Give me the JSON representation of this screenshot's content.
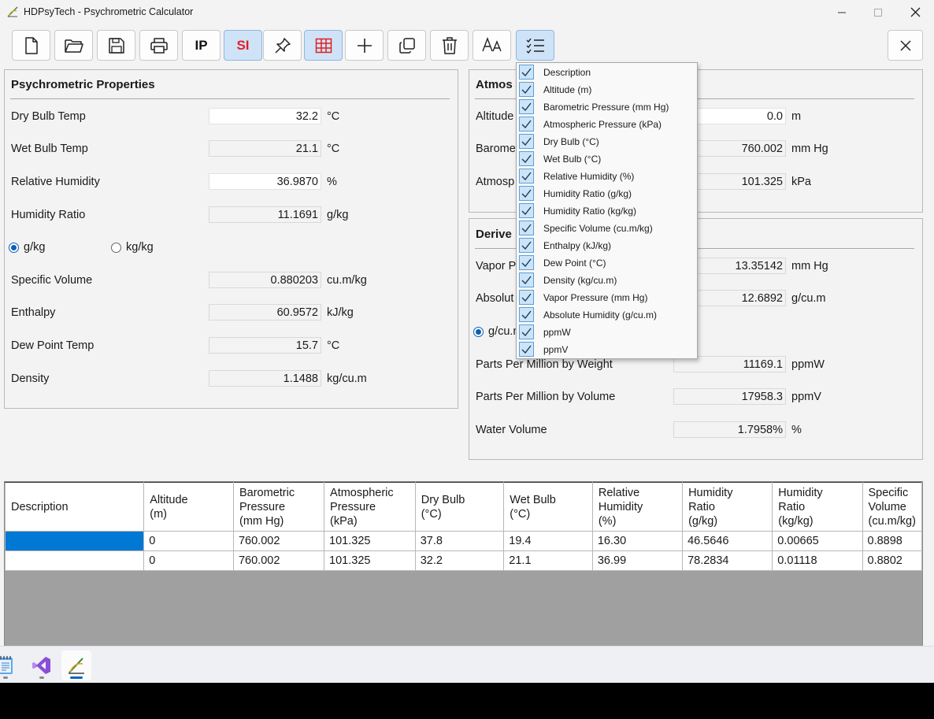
{
  "window": {
    "title": "HDPsyTech - Psychrometric Calculator"
  },
  "toolbar": {
    "buttons": [
      {
        "name": "new-file",
        "icon": "new-file-icon"
      },
      {
        "name": "open-folder",
        "icon": "folder-icon"
      },
      {
        "name": "save",
        "icon": "save-icon"
      },
      {
        "name": "print",
        "icon": "printer-icon"
      },
      {
        "name": "ip-units",
        "label": "IP"
      },
      {
        "name": "si-units",
        "label": "SI",
        "active": true
      },
      {
        "name": "pin",
        "icon": "pin-icon"
      },
      {
        "name": "grid",
        "icon": "grid-icon",
        "active": true
      },
      {
        "name": "add",
        "icon": "plus-icon"
      },
      {
        "name": "copy",
        "icon": "copy-icon"
      },
      {
        "name": "delete",
        "icon": "trash-icon"
      },
      {
        "name": "font",
        "icon": "font-size-icon"
      },
      {
        "name": "columns",
        "icon": "checklist-icon",
        "active": true
      }
    ],
    "close_icon": "close-icon"
  },
  "psychrometric": {
    "title": "Psychrometric Properties",
    "dry_bulb": {
      "label": "Dry Bulb Temp",
      "value": "32.2",
      "unit": "°C"
    },
    "wet_bulb": {
      "label": "Wet Bulb Temp",
      "value": "21.1",
      "unit": "°C"
    },
    "rel_humidity": {
      "label": "Relative Humidity",
      "value": "36.9870",
      "unit": "%"
    },
    "humidity_ratio": {
      "label": "Humidity Ratio",
      "value": "11.1691",
      "unit": "g/kg"
    },
    "radio_gkg": "g/kg",
    "radio_kgkg": "kg/kg",
    "specific_volume": {
      "label": "Specific Volume",
      "value": "0.880203",
      "unit": "cu.m/kg"
    },
    "enthalpy": {
      "label": "Enthalpy",
      "value": "60.9572",
      "unit": "kJ/kg"
    },
    "dew_point": {
      "label": "Dew Point Temp",
      "value": "15.7",
      "unit": "°C"
    },
    "density": {
      "label": "Density",
      "value": "1.1488",
      "unit": "kg/cu.m"
    }
  },
  "atmospheric": {
    "title": "Atmos",
    "altitude": {
      "label": "Altitude",
      "value": "0.0",
      "unit": "m"
    },
    "barometric": {
      "label": "Barome",
      "value": "760.002",
      "unit": "mm Hg"
    },
    "atmospheric": {
      "label": "Atmosp",
      "value": "101.325",
      "unit": "kPa"
    }
  },
  "derived": {
    "title": "Derive",
    "vapor_pressure": {
      "label": "Vapor P",
      "value": "13.35142",
      "unit": "mm Hg"
    },
    "absolute_humidity": {
      "label": "Absolut",
      "value": "12.6892",
      "unit": "g/cu.m"
    },
    "radio_gcum": "g/cu.m",
    "ppmw": {
      "label": "Parts Per Million by Weight",
      "value": "11169.1",
      "unit": "ppmW"
    },
    "ppmv": {
      "label": "Parts Per Million by Volume",
      "value": "17958.3",
      "unit": "ppmV"
    },
    "water_volume": {
      "label": "Water Volume",
      "value": "1.7958%",
      "unit": "%"
    }
  },
  "column_menu": {
    "items": [
      "Description",
      "Altitude (m)",
      "Barometric Pressure (mm Hg)",
      "Atmospheric Pressure (kPa)",
      "Dry Bulb (°C)",
      "Wet Bulb (°C)",
      "Relative Humidity (%)",
      "Humidity Ratio (g/kg)",
      "Humidity Ratio (kg/kg)",
      "Specific Volume (cu.m/kg)",
      "Enthalpy (kJ/kg)",
      "Dew Point (°C)",
      "Density (kg/cu.m)",
      "Vapor Pressure (mm Hg)",
      "Absolute Humidity (g/cu.m)",
      "ppmW",
      "ppmV"
    ]
  },
  "table": {
    "headers": [
      "Description",
      "Altitude\n(m)",
      "Barometric\nPressure\n(mm Hg)",
      "Atmospheric\nPressure\n(kPa)",
      "Dry Bulb\n(°C)",
      "Wet Bulb\n(°C)",
      "Relative\nHumidity\n(%)",
      "Humidity\nRatio\n(g/kg)",
      "Humidity\nRatio\n(kg/kg)",
      "Specific\nVolume\n(cu.m/kg)"
    ],
    "rows": [
      [
        "",
        "0",
        "760.002",
        "101.325",
        "37.8",
        "19.4",
        "16.30",
        "46.5646",
        "0.00665",
        "0.8898"
      ],
      [
        "",
        "0",
        "760.002",
        "101.325",
        "32.2",
        "21.1",
        "36.99",
        "78.2834",
        "0.01118",
        "0.8802"
      ]
    ]
  },
  "taskbar": {
    "items": [
      {
        "name": "notepad",
        "icon": "notepad-icon"
      },
      {
        "name": "visual-studio",
        "icon": "visual-studio-icon"
      },
      {
        "name": "hdpsytech",
        "icon": "hdpsytech-icon",
        "active": true
      }
    ]
  },
  "colors": {
    "accent": "#0078d4",
    "si_label": "#e02020",
    "active_button": "#cfe3f8"
  }
}
